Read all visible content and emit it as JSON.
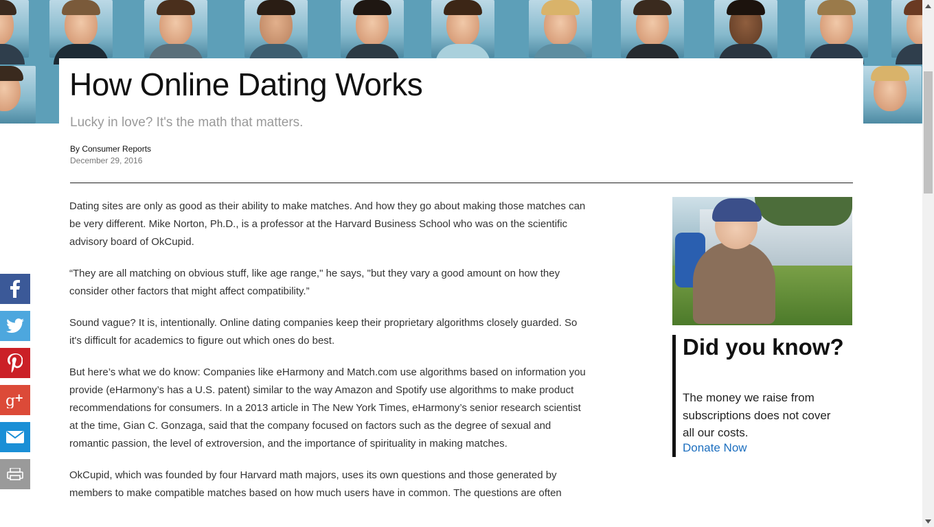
{
  "article": {
    "title": "How Online Dating Works",
    "subtitle": "Lucky in love? It's the math that matters.",
    "byline": "By Consumer Reports",
    "date": "December 29, 2016",
    "paragraphs": [
      "Dating sites are only as good as their ability to make matches. And how they go about making those matches can be very different. Mike Norton, Ph.D., is a professor at the Harvard Business School who was on the scientific advisory board of OkCupid.",
      "“They are all matching on obvious stuff, like age range,\" he says, \"but they vary a good amount on how they consider other factors that might affect compatibility.”",
      "Sound vague? It is, intentionally. Online dating companies keep their proprietary algorithms closely guarded. So it's difficult for academics to figure out which ones do best.",
      "But here’s what we do know: Companies like eHarmony and Match.com use algorithms based on information you provide (eHarmony’s has a U.S. patent) similar to the way Amazon and Spotify use algorithms to make product recommendations for consumers. In a 2013 article in The New York Times, eHarmony’s senior research scientist at the time, Gian C. Gonzaga, said that the company focused on factors such as the degree of sexual and romantic passion, the level of extroversion, and the importance of spirituality in making matches.",
      "OkCupid, which was founded by four Harvard math majors, uses its own questions and those generated by members to make compatible matches based on how much users have in common. The questions are often"
    ]
  },
  "sidebar": {
    "heading": "Did you know?",
    "message": "The money we raise from subscriptions does not cover all our costs.",
    "donate_label": "Donate Now"
  },
  "share": [
    {
      "icon": "facebook-icon",
      "color": "#3b5998"
    },
    {
      "icon": "twitter-icon",
      "color": "#4da7de"
    },
    {
      "icon": "pinterest-icon",
      "color": "#cb2027"
    },
    {
      "icon": "google-plus-icon",
      "color": "#dc4a38"
    },
    {
      "icon": "email-icon",
      "color": "#1a8fd6"
    },
    {
      "icon": "print-icon",
      "color": "#9a9a9a"
    }
  ]
}
